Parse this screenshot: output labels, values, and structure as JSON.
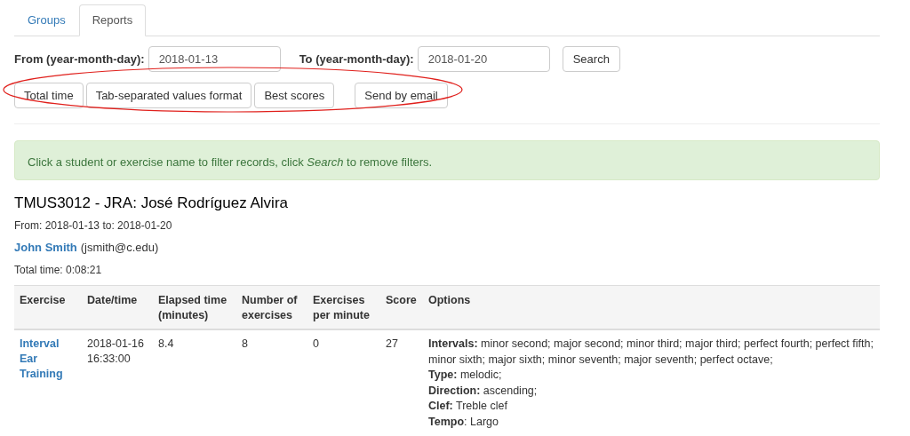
{
  "tabs": [
    {
      "label": "Groups",
      "selected": false
    },
    {
      "label": "Reports",
      "selected": true
    }
  ],
  "filters": {
    "from": {
      "label": "From (year-month-day):",
      "value": "2018-01-13"
    },
    "to": {
      "label": "To (year-month-day):",
      "value": "2018-01-20"
    },
    "search_button": "Search"
  },
  "export_buttons": [
    "Total time",
    "Tab-separated values format",
    "Best scores",
    "Send by email"
  ],
  "alert": "Click a student or exercise name to filter records, click *Search* to remove filters.",
  "report": {
    "title": "TMUS3012 - JRA: José Rodríguez Alvira",
    "range": "From: 2018-01-13 to: 2018-01-20",
    "student_name": "John Smith",
    "student_email": "(jsmith@c.edu)",
    "total_time": "Total time: 0:08:21"
  },
  "table": {
    "columns": [
      "Exercise",
      "Date/time",
      "Elapsed time (minutes)",
      "Number of exercises",
      "Exercises per minute",
      "Score",
      "Options"
    ],
    "rows": [
      {
        "exercise": "Interval Ear Training",
        "datetime": "2018-01-16 16:33:00",
        "elapsed": "8.4",
        "count": "8",
        "per_minute": "0",
        "score": "27",
        "options": [
          "**Intervals:** minor second; major second; minor third; major third; perfect fourth; perfect fifth; minor sixth; major sixth; minor seventh; major seventh; perfect octave;",
          "**Type:** melodic;",
          "**Direction:** ascending;",
          "**Clef:** Treble clef",
          "**Tempo**: Largo"
        ]
      }
    ]
  }
}
